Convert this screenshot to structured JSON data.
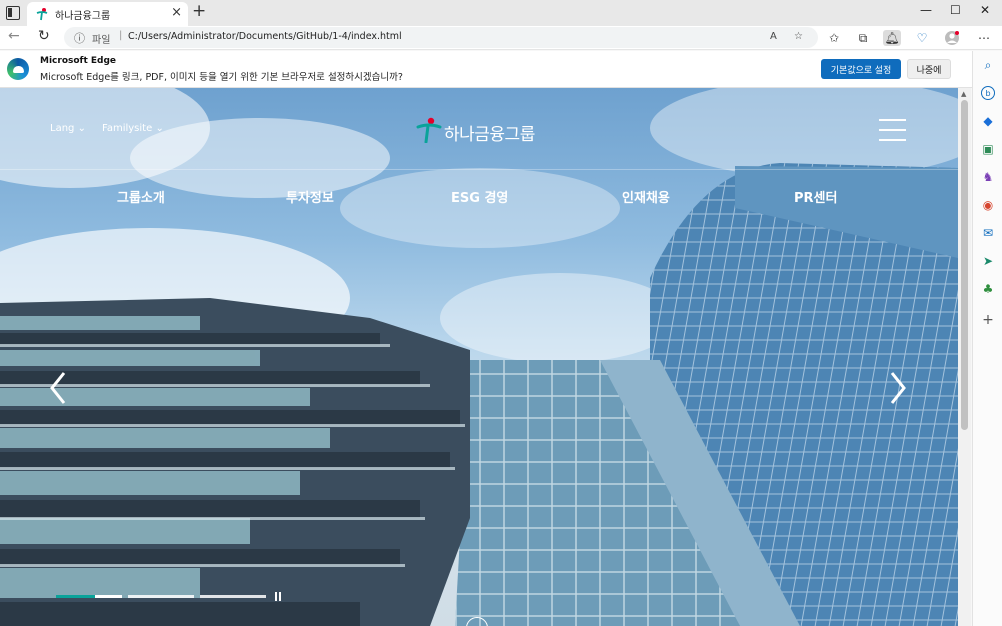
{
  "browser": {
    "tab_title": "하나금융그룹",
    "url_label": "파일",
    "url": "C:/Users/Administrator/Documents/GitHub/1-4/index.html",
    "read_aloud": "A",
    "window_controls": {
      "minimize": "—",
      "maximize": "☐",
      "close": "✕"
    }
  },
  "infobar": {
    "title": "Microsoft Edge",
    "message": "Microsoft Edge를 링크, PDF, 이미지 등을 열기 위한 기본 브라우저로 설정하시겠습니까?",
    "primary_button": "기본값으로 설정",
    "secondary_button": "나중에"
  },
  "site": {
    "lang_label": "Lang",
    "familysite_label": "Familysite",
    "logo_text": "하나금융그룹",
    "nav": [
      "그룹소개",
      "투자정보",
      "ESG 경영",
      "인재채용",
      "PR센터"
    ],
    "slider": {
      "slide_count": 3,
      "active_slide": 1,
      "active_progress": 0.6
    }
  },
  "colors": {
    "hana_teal": "#0aa39a",
    "hana_red": "#e5002b",
    "edge_blue": "#0f6cbd"
  },
  "sidebar_icons": [
    "search-icon",
    "bing-chat-icon",
    "shopping-tag-icon",
    "tools-briefcase-icon",
    "games-icon",
    "office-icon",
    "outlook-icon",
    "send-icon",
    "drop-tree-icon",
    "add-icon"
  ]
}
